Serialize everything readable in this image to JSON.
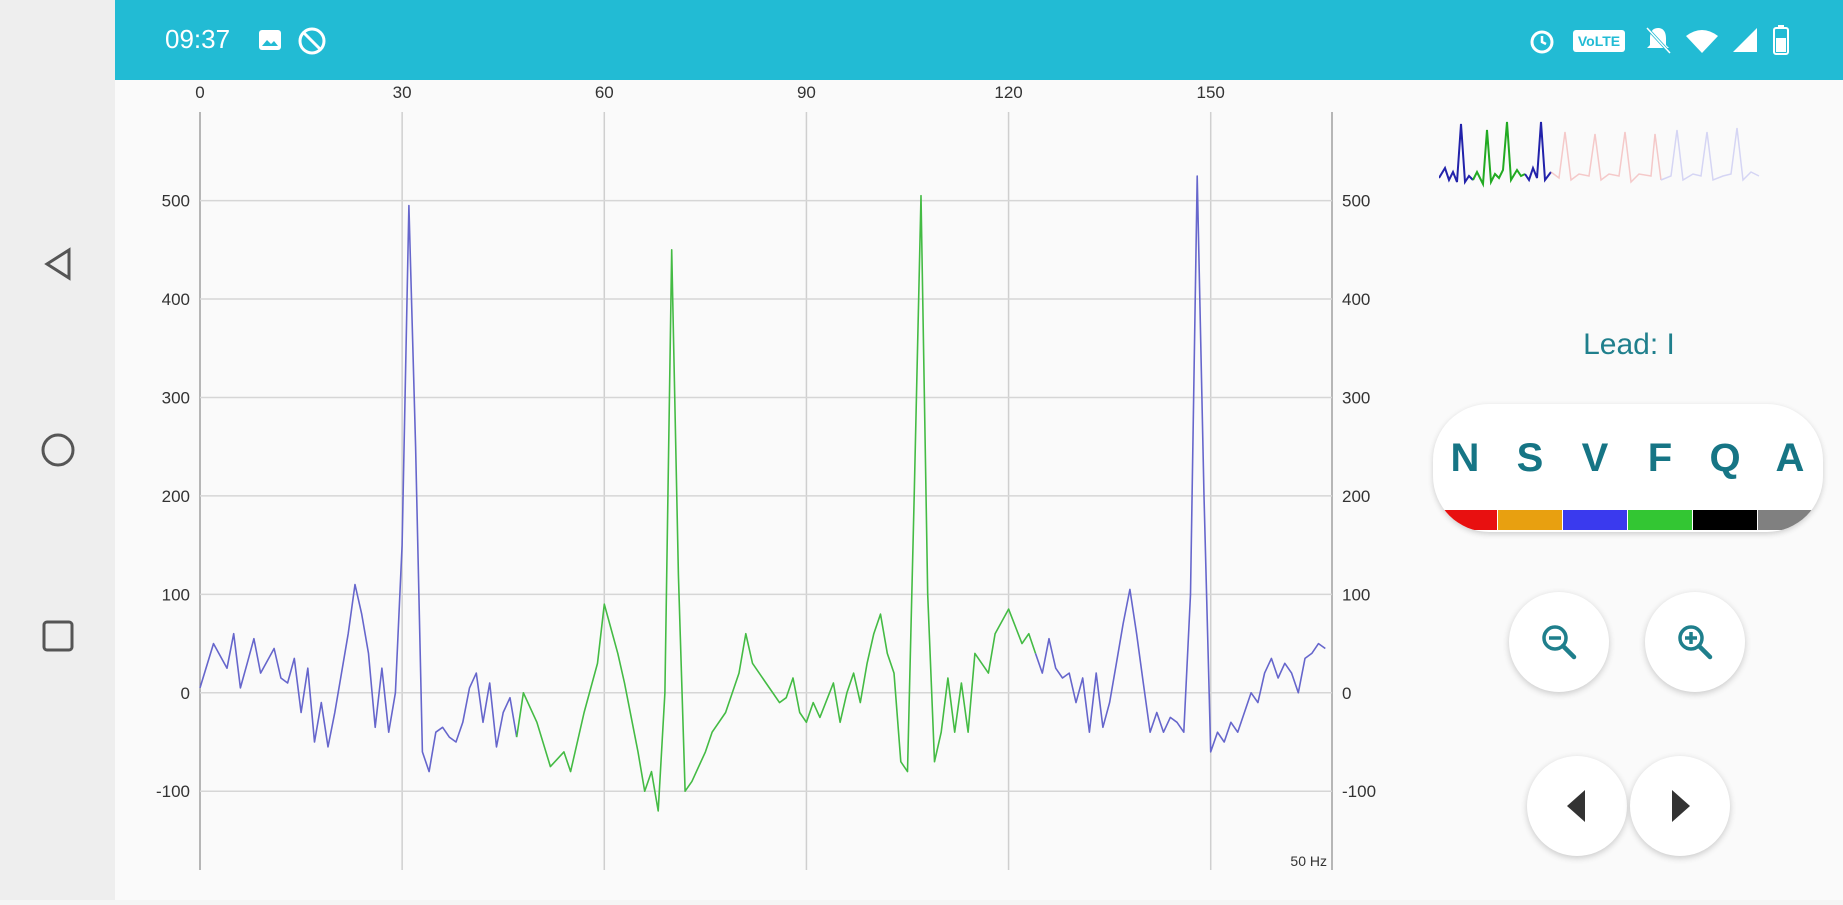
{
  "status_bar": {
    "time": "09:37",
    "left_icons": [
      "image-icon",
      "no-sync-icon"
    ],
    "right_icons": [
      "alarm-icon",
      "volte-badge",
      "dnd-icon",
      "wifi-icon",
      "signal-icon",
      "battery-icon"
    ],
    "volte": "VoLTE"
  },
  "nav_bar": {
    "buttons": [
      "back",
      "home",
      "recents"
    ]
  },
  "chart": {
    "freq_label": "50 Hz",
    "x_ticks": [
      "0",
      "30",
      "60",
      "90",
      "120",
      "150"
    ],
    "y_ticks": [
      "500",
      "400",
      "300",
      "200",
      "100",
      "0",
      "-100"
    ]
  },
  "chart_data": {
    "type": "line",
    "title": "",
    "xlabel": "",
    "ylabel": "",
    "xlim": [
      0,
      168
    ],
    "ylim": [
      -180,
      590
    ],
    "x_ticks": [
      0,
      30,
      60,
      90,
      120,
      150
    ],
    "y_ticks": [
      -100,
      0,
      100,
      200,
      300,
      400,
      500
    ],
    "series": [
      {
        "color": "#6666cc",
        "points": [
          [
            0,
            5
          ],
          [
            2,
            50
          ],
          [
            4,
            25
          ],
          [
            5,
            60
          ],
          [
            6,
            5
          ],
          [
            7,
            30
          ],
          [
            8,
            55
          ],
          [
            9,
            20
          ],
          [
            11,
            45
          ],
          [
            12,
            15
          ],
          [
            13,
            10
          ],
          [
            14,
            35
          ],
          [
            15,
            -20
          ],
          [
            16,
            25
          ],
          [
            17,
            -50
          ],
          [
            18,
            -10
          ],
          [
            19,
            -55
          ],
          [
            20,
            -20
          ],
          [
            21,
            20
          ],
          [
            22,
            60
          ],
          [
            23,
            110
          ],
          [
            24,
            80
          ],
          [
            25,
            40
          ],
          [
            26,
            -35
          ],
          [
            27,
            25
          ],
          [
            28,
            -40
          ],
          [
            29,
            0
          ],
          [
            30,
            150
          ],
          [
            31,
            495
          ],
          [
            32,
            250
          ],
          [
            33,
            -60
          ],
          [
            34,
            -80
          ],
          [
            35,
            -40
          ],
          [
            36,
            -35
          ],
          [
            37,
            -45
          ],
          [
            38,
            -50
          ],
          [
            39,
            -30
          ],
          [
            40,
            5
          ],
          [
            41,
            20
          ],
          [
            42,
            -30
          ],
          [
            43,
            10
          ],
          [
            44,
            -55
          ],
          [
            45,
            -20
          ],
          [
            46,
            -5
          ],
          [
            47,
            -45
          ]
        ]
      },
      {
        "color": "#44bb44",
        "points": [
          [
            47,
            -45
          ],
          [
            48,
            0
          ],
          [
            50,
            -30
          ],
          [
            52,
            -75
          ],
          [
            54,
            -60
          ],
          [
            55,
            -80
          ],
          [
            57,
            -20
          ],
          [
            59,
            30
          ],
          [
            60,
            90
          ],
          [
            62,
            40
          ],
          [
            63,
            10
          ],
          [
            65,
            -60
          ],
          [
            66,
            -100
          ],
          [
            67,
            -80
          ],
          [
            68,
            -120
          ],
          [
            69,
            0
          ],
          [
            70,
            450
          ],
          [
            71,
            120
          ],
          [
            72,
            -100
          ],
          [
            73,
            -90
          ],
          [
            75,
            -60
          ],
          [
            76,
            -40
          ],
          [
            78,
            -20
          ],
          [
            80,
            20
          ],
          [
            81,
            60
          ],
          [
            82,
            30
          ],
          [
            84,
            10
          ],
          [
            86,
            -10
          ],
          [
            87,
            -5
          ],
          [
            88,
            15
          ],
          [
            89,
            -20
          ],
          [
            90,
            -30
          ],
          [
            91,
            -10
          ],
          [
            92,
            -25
          ],
          [
            94,
            10
          ],
          [
            95,
            -30
          ],
          [
            96,
            0
          ],
          [
            97,
            20
          ],
          [
            98,
            -10
          ],
          [
            99,
            30
          ],
          [
            100,
            60
          ],
          [
            101,
            80
          ],
          [
            102,
            40
          ],
          [
            103,
            20
          ],
          [
            104,
            -70
          ],
          [
            105,
            -80
          ],
          [
            106,
            200
          ],
          [
            107,
            505
          ],
          [
            108,
            100
          ],
          [
            109,
            -70
          ],
          [
            110,
            -40
          ],
          [
            111,
            15
          ],
          [
            112,
            -40
          ],
          [
            113,
            10
          ],
          [
            114,
            -40
          ],
          [
            115,
            40
          ],
          [
            117,
            20
          ],
          [
            118,
            60
          ],
          [
            120,
            85
          ],
          [
            122,
            50
          ],
          [
            123,
            60
          ],
          [
            124,
            40
          ]
        ]
      },
      {
        "color": "#6666cc",
        "points": [
          [
            124,
            40
          ],
          [
            125,
            20
          ],
          [
            126,
            55
          ],
          [
            127,
            25
          ],
          [
            128,
            15
          ],
          [
            129,
            20
          ],
          [
            130,
            -10
          ],
          [
            131,
            15
          ],
          [
            132,
            -40
          ],
          [
            133,
            20
          ],
          [
            134,
            -35
          ],
          [
            135,
            -10
          ],
          [
            136,
            30
          ],
          [
            137,
            70
          ],
          [
            138,
            105
          ],
          [
            139,
            60
          ],
          [
            140,
            10
          ],
          [
            141,
            -40
          ],
          [
            142,
            -20
          ],
          [
            143,
            -40
          ],
          [
            144,
            -25
          ],
          [
            145,
            -30
          ],
          [
            146,
            -40
          ],
          [
            147,
            100
          ],
          [
            148,
            525
          ],
          [
            149,
            200
          ],
          [
            150,
            -60
          ],
          [
            151,
            -40
          ],
          [
            152,
            -50
          ],
          [
            153,
            -30
          ],
          [
            154,
            -40
          ],
          [
            155,
            -20
          ],
          [
            156,
            0
          ],
          [
            157,
            -10
          ],
          [
            158,
            20
          ],
          [
            159,
            35
          ],
          [
            160,
            15
          ],
          [
            161,
            30
          ],
          [
            162,
            20
          ],
          [
            163,
            0
          ],
          [
            164,
            35
          ],
          [
            165,
            40
          ],
          [
            166,
            50
          ],
          [
            167,
            45
          ]
        ]
      }
    ]
  },
  "side": {
    "lead_label": "Lead: I",
    "classes": [
      {
        "letter": "N",
        "color": "#e81010"
      },
      {
        "letter": "S",
        "color": "#e8a010"
      },
      {
        "letter": "V",
        "color": "#3a3aee"
      },
      {
        "letter": "F",
        "color": "#33c633"
      },
      {
        "letter": "Q",
        "color": "#000000"
      },
      {
        "letter": "A",
        "color": "#808080"
      }
    ],
    "accent": "#1f7f8c"
  }
}
